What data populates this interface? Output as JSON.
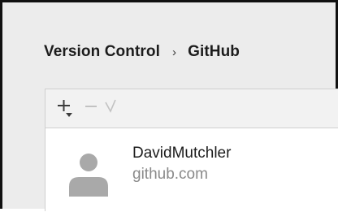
{
  "breadcrumb": {
    "items": [
      "Version Control",
      "GitHub"
    ],
    "separator": "›"
  },
  "toolbar": {
    "add": {
      "icon": "plus-with-dropdown-icon",
      "enabled": true
    },
    "remove": {
      "icon": "minus-icon",
      "enabled": false
    },
    "set_default": {
      "icon": "checkmark-icon",
      "enabled": false
    }
  },
  "accounts": [
    {
      "name": "DavidMutchler",
      "server": "github.com",
      "avatar_icon": "default-user-avatar-icon"
    }
  ],
  "colors": {
    "text_primary": "#1c1c1c",
    "text_secondary": "#8a8a8a",
    "icon_enabled": "#3c3c3c",
    "icon_disabled": "#c2c2c2",
    "avatar": "#a9a9a9",
    "background": "#ececec",
    "toolbar_background": "#f2f2f2"
  }
}
